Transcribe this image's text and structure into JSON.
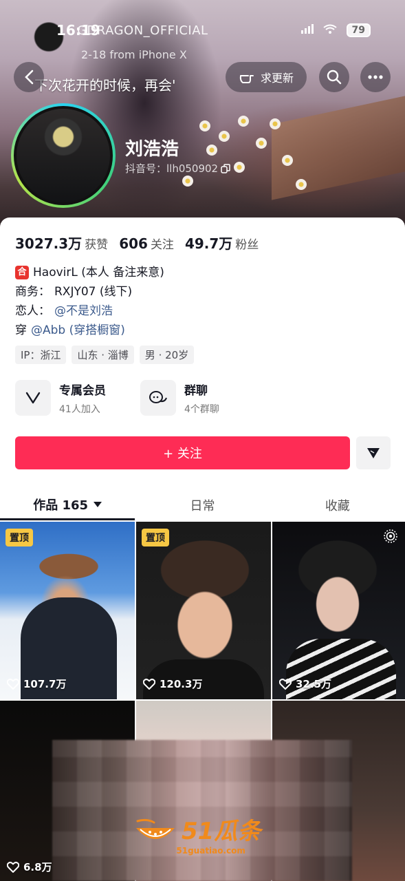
{
  "status_bar": {
    "time": "16:19",
    "battery": "79"
  },
  "post": {
    "author": "GDRAGON_OFFICIAL",
    "date": "2-18",
    "source": "from iPhone X",
    "caption": "下次花开的时候，再会'"
  },
  "header": {
    "update_label": "求更新"
  },
  "profile": {
    "name": "刘浩浩",
    "douyin_id": "抖音号：llh050902"
  },
  "stats": [
    {
      "value": "3027.3万",
      "label": "获赞"
    },
    {
      "value": "606",
      "label": "关注"
    },
    {
      "value": "49.7万",
      "label": "粉丝"
    }
  ],
  "bio": {
    "line1_badge": "合",
    "line1_text": "HaovirL (本人 备注来意)",
    "line2_label": "商务：",
    "line2_text": "RXJY07 (线下)",
    "line3_label": "恋人：",
    "line3_mention": "@不是刘浩",
    "line4_label": "穿",
    "line4_mention": "@Abb (穿搭橱窗)"
  },
  "tags": [
    "IP：浙江",
    "山东 · 淄博",
    "男 · 20岁"
  ],
  "features": [
    {
      "title": "专属会员",
      "subtitle": "41人加入",
      "icon": "v-membership-icon"
    },
    {
      "title": "群聊",
      "subtitle": "4个群聊",
      "icon": "group-chat-icon"
    }
  ],
  "follow_label": "+ 关注",
  "tabs": [
    {
      "label": "作品 165",
      "active": true
    },
    {
      "label": "日常",
      "active": false
    },
    {
      "label": "收藏",
      "active": false
    }
  ],
  "videos": [
    {
      "likes": "107.7万",
      "pinned": true,
      "pin_label": "置顶"
    },
    {
      "likes": "120.3万",
      "pinned": true,
      "pin_label": "置顶"
    },
    {
      "likes": "32.5万",
      "pinned": false
    },
    {
      "likes": "6.8万",
      "pinned": false
    },
    {
      "likes": "",
      "pinned": false
    },
    {
      "likes": "",
      "pinned": false
    }
  ],
  "watermark": {
    "main": "51瓜条",
    "sub": "51guatiao.com"
  },
  "colors": {
    "follow_button": "#fe2c55",
    "pin_badge": "#f6c744",
    "mention": "#3b5a8c"
  }
}
